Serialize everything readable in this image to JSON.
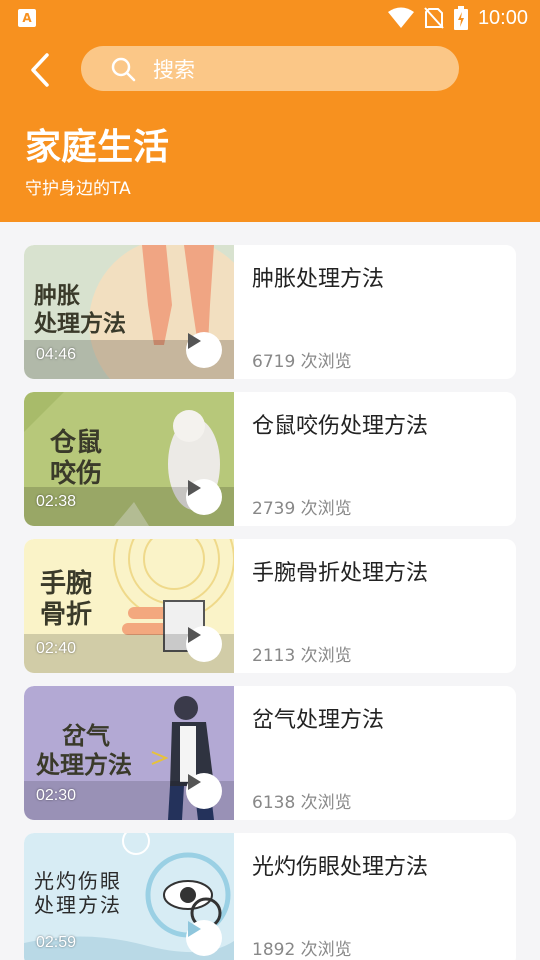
{
  "status_bar": {
    "time": "10:00",
    "app_icon_letter": "A"
  },
  "header": {
    "search_placeholder": "搜索",
    "title": "家庭生活",
    "subtitle": "守护身边的TA"
  },
  "videos": [
    {
      "title": "肿胀处理方法",
      "views": "6719 次浏览",
      "duration": "04:46",
      "thumb_line1": "肿胀",
      "thumb_line2": "处理方法"
    },
    {
      "title": "仓鼠咬伤处理方法",
      "views": "2739 次浏览",
      "duration": "02:38",
      "thumb_line1": "仓鼠",
      "thumb_line2": "咬伤"
    },
    {
      "title": "手腕骨折处理方法",
      "views": "2113 次浏览",
      "duration": "02:40",
      "thumb_line1": "手腕",
      "thumb_line2": "骨折"
    },
    {
      "title": "岔气处理方法",
      "views": "6138 次浏览",
      "duration": "02:30",
      "thumb_line1": "岔气",
      "thumb_line2": "处理方法"
    },
    {
      "title": "光灼伤眼处理方法",
      "views": "1892 次浏览",
      "duration": "02:59",
      "thumb_line1": "光灼伤眼",
      "thumb_line2": "处理方法"
    }
  ],
  "colors": {
    "header_bg": "#f7911f",
    "search_bg": "#fbc787",
    "page_bg": "#f5f5f7"
  },
  "icons": [
    "app-notification-icon",
    "wifi-icon",
    "no-sim-icon",
    "battery-icon",
    "back-arrow-icon",
    "search-icon",
    "play-icon"
  ]
}
